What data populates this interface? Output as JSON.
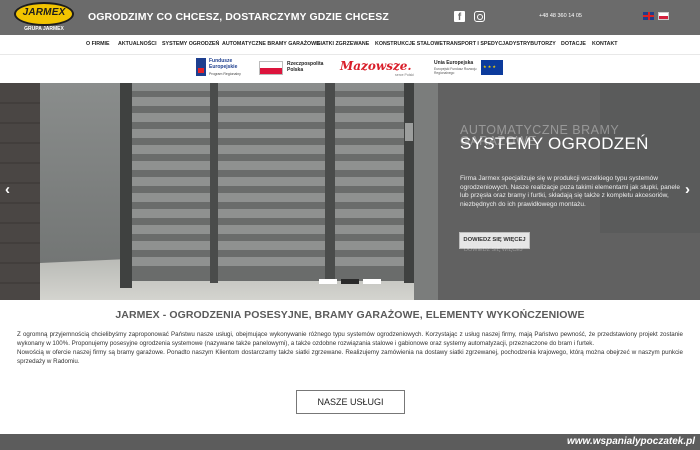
{
  "header": {
    "logo_text": "JARMEX",
    "logo_sub": "GRUPA JARMEX",
    "slogan": "OGRODZIMY CO CHCESZ, DOSTARCZYMY GDZIE CHCESZ",
    "phone": "+48 48 360 14 05",
    "social": [
      "facebook-icon",
      "instagram-icon"
    ],
    "languages": [
      "en",
      "pl"
    ],
    "colors": {
      "bar": "#6b6b6b",
      "logo_yellow": "#f2c400"
    }
  },
  "nav": {
    "items": [
      "O FIRMIE",
      "AKTUALNOŚCI",
      "SYSTEMY OGRODZEŃ",
      "AUTOMATYCZNE BRAMY GARAŻOWE",
      "SIATKI ZGRZEWANE",
      "KONSTRUKCJE STALOWE",
      "TRANSPORT I SPEDYCJA",
      "DYSTRYBUTORZY",
      "DOTACJE",
      "KONTAKT"
    ]
  },
  "partners": {
    "fe_title": "Fundusze Europejskie",
    "fe_sub": "Program Regionalny",
    "rp_line1": "Rzeczpospolita",
    "rp_line2": "Polska",
    "mazowsze": "Mazowsze.",
    "mazowsze_sub": "serce Polski",
    "ue_title": "Unia Europejska",
    "ue_sub": "Europejski Fundusz Rozwoju Regionalnego"
  },
  "slider": {
    "ghost_title": "AUTOMATYCZNE BRAMY GARAŻOWE",
    "title": "SYSTEMY OGRODZEŃ",
    "description": "Firma Jarmex specjalizuje się w produkcji wszelkiego typu systemów ogrodzeniowych. Nasze realizacje poza takimi elementami jak słupki, panele lub przęsła oraz bramy i furtki, składają się także z kompletu akcesoriów, niezbędnych do ich prawidłowego montażu.",
    "button": "DOWIEDZ SIĘ WIĘCEJ",
    "ghost_button": "DOWIEDZ SIĘ WIĘCEJ",
    "prev": "‹",
    "next": "›",
    "active_dot": 2,
    "dots": 3
  },
  "content": {
    "headline": "JARMEX - OGRODZENIA POSESYJNE, BRAMY GARAŻOWE, ELEMENTY WYKOŃCZENIOWE",
    "paragraph1": "Z ogromną przyjemnością chcielibyśmy zaproponować Państwu nasze usługi, obejmujące wykonywanie różnego typu systemów ogrodzeniowych. Korzystając z usług naszej firmy, mają Państwo pewność, że przedstawiony projekt zostanie wykonany w 100%. Proponujemy posesyjne ogrodzenia systemowe (nazywane także panelowymi), a także ozdobne rozwiązania stalowe i gabionowe oraz systemy automatyzacji, przeznaczone do bram i furtek.",
    "paragraph2": "Nowością w ofercie naszej firmy są bramy garażowe. Ponadto naszym Klientom dostarczamy także siatki zgrzewane. Realizujemy zamówienia na dostawy siatki zgrzewanej, pochodzenia krajowego, którą można obejrzeć w naszym punkcie sprzedaży w Radomiu.",
    "services_button": "NASZE USŁUGI"
  },
  "footer": {
    "watermark": "www.wspanialypoczatek.pl"
  }
}
